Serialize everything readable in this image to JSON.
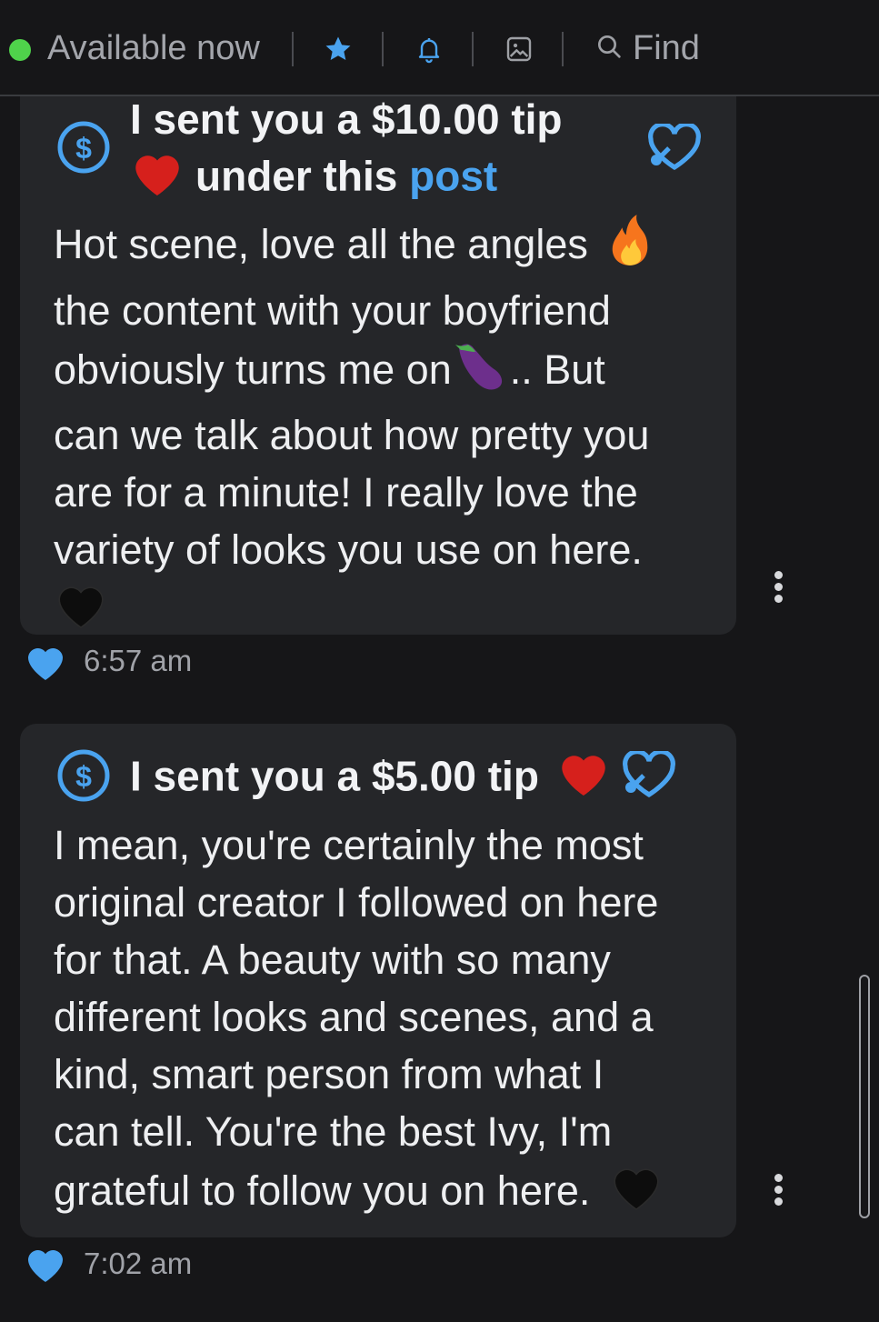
{
  "header": {
    "status_label": "Available now",
    "find_label": "Find",
    "status_color": "#4fd34b",
    "accent_color": "#4aa3ef"
  },
  "messages": [
    {
      "tip_line_1": "I sent you a $10.00 tip",
      "tip_line_2_text": "under this",
      "tip_link": "post",
      "body_lines": [
        "Hot scene, love all the angles",
        "the content with your boyfriend",
        "obviously turns me on",
        ".. But",
        "can we talk about how pretty you",
        "are for a minute! I really love the",
        "variety of looks you use on here."
      ],
      "time": "6:57 am"
    },
    {
      "tip_line_1": "I sent you a $5.00 tip",
      "body_lines": [
        "I mean, you're certainly the most",
        "original creator I followed on here",
        "for that. A beauty with so many",
        "different looks and scenes, and a",
        "kind, smart person from what I",
        "can tell. You're the best Ivy, I'm",
        "grateful to follow you on here."
      ],
      "time": "7:02 am"
    }
  ]
}
